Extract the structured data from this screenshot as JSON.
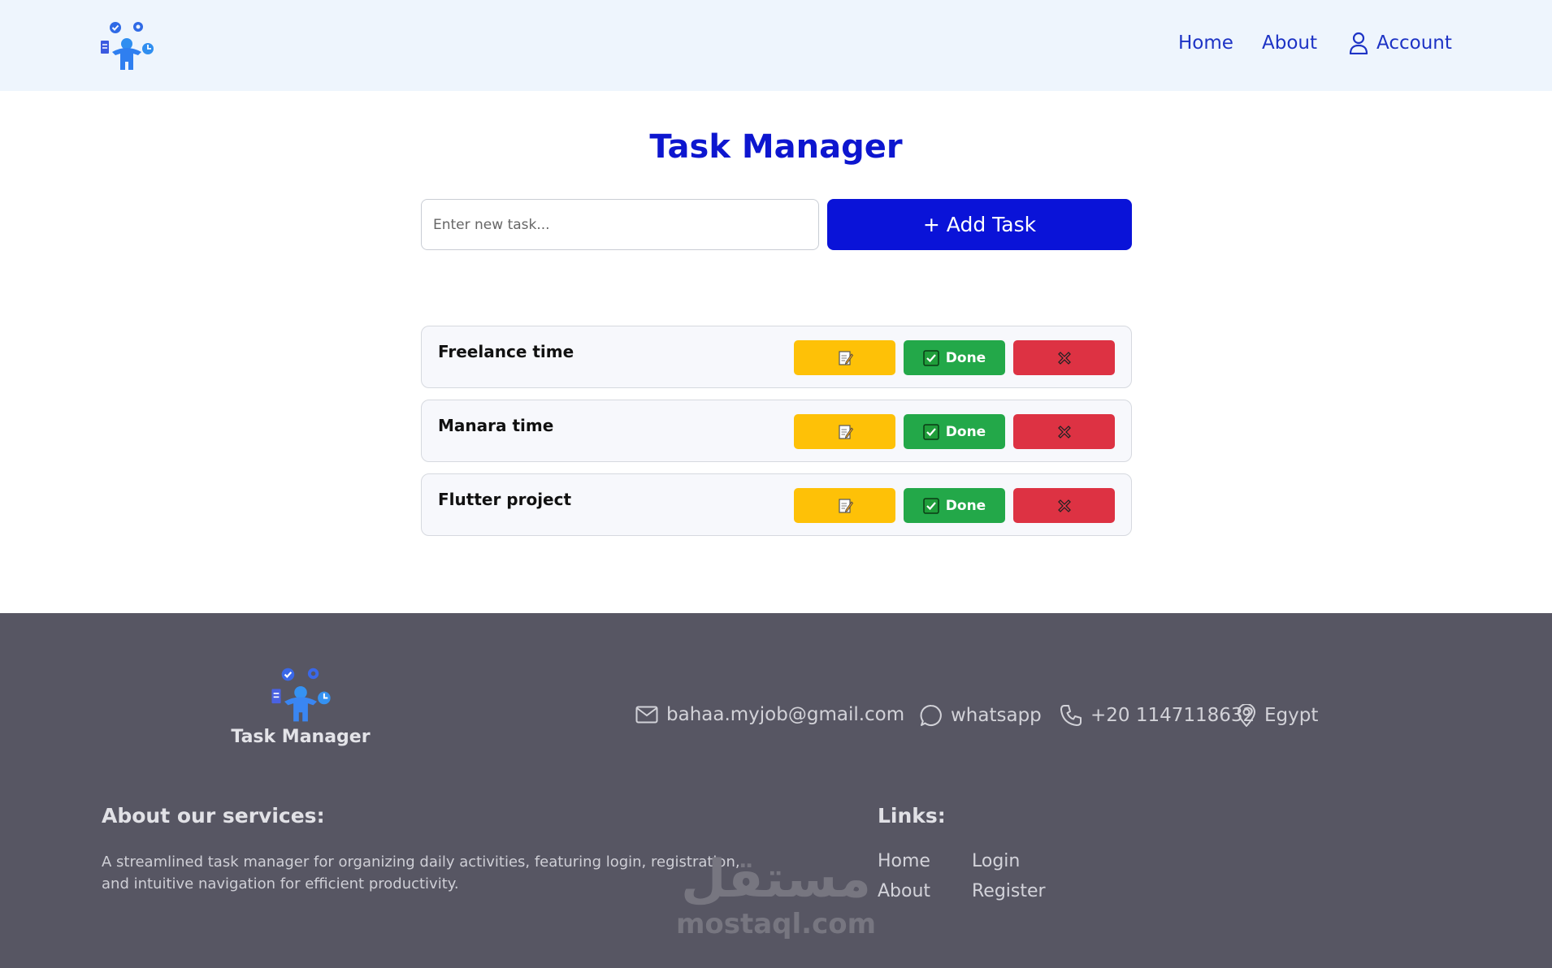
{
  "header": {
    "nav": {
      "home": "Home",
      "about": "About",
      "account": "Account"
    }
  },
  "main": {
    "title": "Task Manager",
    "input_placeholder": "Enter new task...",
    "add_button": "+ Add Task",
    "tasks": [
      {
        "name": "Freelance time",
        "done_label": "Done"
      },
      {
        "name": "Manara time",
        "done_label": "Done"
      },
      {
        "name": "Flutter project",
        "done_label": "Done"
      }
    ]
  },
  "footer": {
    "brand": "Task Manager",
    "contact": {
      "email": "bahaa.myjob@gmail.com",
      "whatsapp": "whatsapp",
      "phone": "+20 1147118632",
      "location": "Egypt"
    },
    "about_heading": "About our services:",
    "about_text": "A streamlined task manager for organizing daily activities, featuring login, registration, and intuitive navigation for efficient productivity.",
    "links_heading": "Links:",
    "links": {
      "home": "Home",
      "about": "About",
      "login": "Login",
      "register": "Register"
    }
  },
  "watermark": {
    "arabic": "مستقل",
    "latin": "mostaql.com"
  },
  "colors": {
    "header_bg": "#eef5fd",
    "primary": "#0a13d8",
    "edit": "#fec107",
    "done": "#23a849",
    "delete": "#dd3243",
    "footer_bg": "#575663"
  }
}
